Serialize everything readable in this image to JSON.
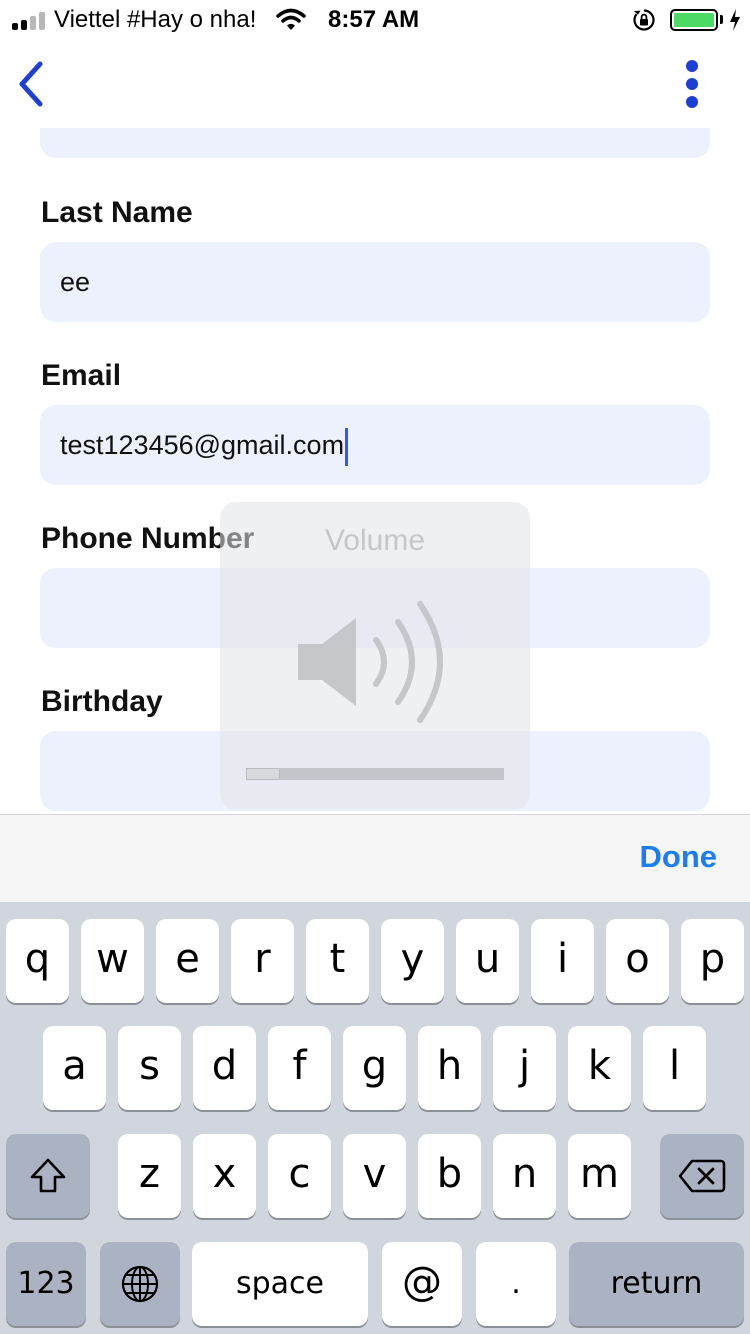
{
  "status_bar": {
    "carrier": "Viettel #Hay o nha!",
    "time": "8:57 AM",
    "battery_color": "#4cd964",
    "icons": [
      "signal-icon",
      "wifi-icon",
      "rotation-lock-icon",
      "battery-icon",
      "charging-icon"
    ]
  },
  "nav": {
    "back_icon": "chevron-left-icon",
    "menu_icon": "more-vertical-icon",
    "accent_color": "#1e3fd6"
  },
  "form": {
    "fields": [
      {
        "label": "Last Name",
        "value": "ee"
      },
      {
        "label": "Email",
        "value": "test123456@gmail.com",
        "focused": true
      },
      {
        "label": "Phone Number",
        "value": ""
      },
      {
        "label": "Birthday",
        "value": ""
      }
    ],
    "input_bg_color": "#edf1fd"
  },
  "volume_hud": {
    "title": "Volume",
    "icon": "speaker-icon",
    "level_percent": 13
  },
  "keyboard_toolbar": {
    "done_label": "Done",
    "done_color": "#1a7ef2"
  },
  "keyboard": {
    "row1": [
      "q",
      "w",
      "e",
      "r",
      "t",
      "y",
      "u",
      "i",
      "o",
      "p"
    ],
    "row2": [
      "a",
      "s",
      "d",
      "f",
      "g",
      "h",
      "j",
      "k",
      "l"
    ],
    "row3": [
      "z",
      "x",
      "c",
      "v",
      "b",
      "n",
      "m"
    ],
    "numbers_label": "123",
    "space_label": "space",
    "at_label": "@",
    "period_label": ".",
    "return_label": "return",
    "icons": [
      "shift-icon",
      "backspace-icon",
      "globe-icon"
    ]
  }
}
